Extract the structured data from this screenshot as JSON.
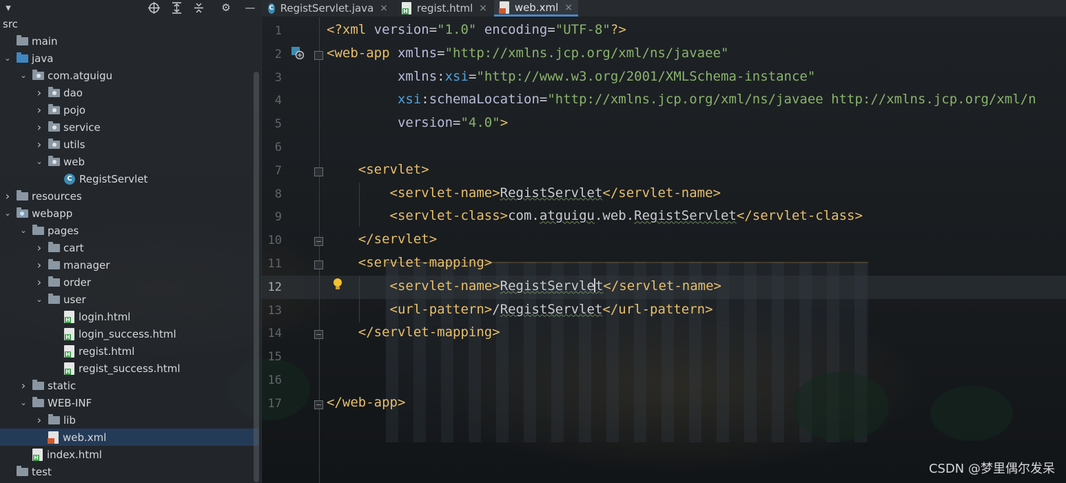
{
  "colors": {
    "tag": "#e8bf6a",
    "attribute": "#b9bcd9",
    "namespace": "#4fa3dd",
    "string": "#6a8759",
    "selection": "#254060",
    "tab_accent": "#4a88c7"
  },
  "sidebar": {
    "toolbar_icons": [
      "target-icon",
      "expand-all-icon",
      "collapse-all-icon",
      "gear-icon",
      "minimize-icon"
    ],
    "tree": [
      {
        "label": "src",
        "level": 0,
        "icon": "none",
        "chevron": "none"
      },
      {
        "label": "main",
        "level": 0,
        "icon": "folder",
        "chevron": "none"
      },
      {
        "label": "java",
        "level": 0,
        "icon": "folder-blue",
        "chevron": "open"
      },
      {
        "label": "com.atguigu",
        "level": 1,
        "icon": "package",
        "chevron": "open"
      },
      {
        "label": "dao",
        "level": 2,
        "icon": "package",
        "chevron": "closed"
      },
      {
        "label": "pojo",
        "level": 2,
        "icon": "package",
        "chevron": "closed"
      },
      {
        "label": "service",
        "level": 2,
        "icon": "package",
        "chevron": "closed"
      },
      {
        "label": "utils",
        "level": 2,
        "icon": "package",
        "chevron": "closed"
      },
      {
        "label": "web",
        "level": 2,
        "icon": "package",
        "chevron": "open"
      },
      {
        "label": "RegistServlet",
        "level": 3,
        "icon": "class",
        "chevron": "none"
      },
      {
        "label": "resources",
        "level": 0,
        "icon": "folder",
        "chevron": "closed"
      },
      {
        "label": "webapp",
        "level": 0,
        "icon": "folder-web",
        "chevron": "open"
      },
      {
        "label": "pages",
        "level": 1,
        "icon": "folder",
        "chevron": "open"
      },
      {
        "label": "cart",
        "level": 2,
        "icon": "folder",
        "chevron": "closed"
      },
      {
        "label": "manager",
        "level": 2,
        "icon": "folder",
        "chevron": "closed"
      },
      {
        "label": "order",
        "level": 2,
        "icon": "folder",
        "chevron": "closed"
      },
      {
        "label": "user",
        "level": 2,
        "icon": "folder",
        "chevron": "open"
      },
      {
        "label": "login.html",
        "level": 3,
        "icon": "html",
        "chevron": "none"
      },
      {
        "label": "login_success.html",
        "level": 3,
        "icon": "html",
        "chevron": "none"
      },
      {
        "label": "regist.html",
        "level": 3,
        "icon": "html",
        "chevron": "none"
      },
      {
        "label": "regist_success.html",
        "level": 3,
        "icon": "html",
        "chevron": "none"
      },
      {
        "label": "static",
        "level": 1,
        "icon": "folder",
        "chevron": "closed"
      },
      {
        "label": "WEB-INF",
        "level": 1,
        "icon": "folder",
        "chevron": "open"
      },
      {
        "label": "lib",
        "level": 2,
        "icon": "folder",
        "chevron": "closed"
      },
      {
        "label": "web.xml",
        "level": 2,
        "icon": "xml",
        "chevron": "none",
        "selected": true
      },
      {
        "label": "index.html",
        "level": 1,
        "icon": "html",
        "chevron": "none"
      },
      {
        "label": "test",
        "level": 0,
        "icon": "folder",
        "chevron": "none"
      }
    ]
  },
  "tabs": [
    {
      "label": "RegistServlet.java",
      "icon": "java-class-icon",
      "active": false
    },
    {
      "label": "regist.html",
      "icon": "html-file-icon",
      "active": false
    },
    {
      "label": "web.xml",
      "icon": "xml-file-icon",
      "active": true
    }
  ],
  "tab_close_glyph": "×",
  "editor": {
    "current_line": 12,
    "lines": [
      {
        "n": "1",
        "parts": [
          [
            "k",
            "<?xml "
          ],
          [
            "a",
            "version"
          ],
          [
            "t",
            "="
          ],
          [
            "v",
            "\"1.0\""
          ],
          [
            "t",
            " "
          ],
          [
            "a",
            "encoding"
          ],
          [
            "t",
            "="
          ],
          [
            "v",
            "\"UTF-8\""
          ],
          [
            "k",
            "?>"
          ]
        ]
      },
      {
        "n": "2",
        "parts": [
          [
            "k",
            "<web-app "
          ],
          [
            "a",
            "xmlns"
          ],
          [
            "t",
            "="
          ],
          [
            "v",
            "\"http://xmlns.jcp.org/xml/ns/javaee\""
          ]
        ]
      },
      {
        "n": "3",
        "parts": [
          [
            "t",
            "         "
          ],
          [
            "a",
            "xmlns"
          ],
          [
            "t",
            ":"
          ],
          [
            "ns",
            "xsi"
          ],
          [
            "t",
            "="
          ],
          [
            "v",
            "\"http://www.w3.org/2001/XMLSchema-instance\""
          ]
        ]
      },
      {
        "n": "4",
        "parts": [
          [
            "t",
            "         "
          ],
          [
            "ns",
            "xsi"
          ],
          [
            "t",
            ":"
          ],
          [
            "a",
            "schemaLocation"
          ],
          [
            "t",
            "="
          ],
          [
            "v",
            "\"http://xmlns.jcp.org/xml/ns/javaee http://xmlns.jcp.org/xml/n"
          ]
        ]
      },
      {
        "n": "5",
        "parts": [
          [
            "t",
            "         "
          ],
          [
            "a",
            "version"
          ],
          [
            "t",
            "="
          ],
          [
            "v",
            "\"4.0\""
          ],
          [
            "k",
            ">"
          ]
        ]
      },
      {
        "n": "6",
        "parts": []
      },
      {
        "n": "7",
        "parts": [
          [
            "t",
            "    "
          ],
          [
            "k",
            "<servlet>"
          ]
        ]
      },
      {
        "n": "8",
        "parts": [
          [
            "t",
            "        "
          ],
          [
            "k",
            "<servlet-name>"
          ],
          [
            "sq",
            "RegistServlet"
          ],
          [
            "k",
            "</servlet-name>"
          ]
        ]
      },
      {
        "n": "9",
        "parts": [
          [
            "t",
            "        "
          ],
          [
            "k",
            "<servlet-class>"
          ],
          [
            "t",
            "com."
          ],
          [
            "sq",
            "atguigu"
          ],
          [
            "t",
            ".web."
          ],
          [
            "sq",
            "RegistServlet"
          ],
          [
            "k",
            "</servlet-class>"
          ]
        ]
      },
      {
        "n": "10",
        "parts": [
          [
            "t",
            "    "
          ],
          [
            "k",
            "</servlet>"
          ]
        ]
      },
      {
        "n": "11",
        "parts": [
          [
            "t",
            "    "
          ],
          [
            "k",
            "<servlet-mapping>"
          ]
        ]
      },
      {
        "n": "12",
        "parts": [
          [
            "t",
            "        "
          ],
          [
            "k",
            "<servlet-name>"
          ],
          [
            "sq",
            "RegistServle"
          ],
          [
            "caret",
            ""
          ],
          [
            "sq",
            "t"
          ],
          [
            "k",
            "</servlet-name>"
          ]
        ]
      },
      {
        "n": "13",
        "parts": [
          [
            "t",
            "        "
          ],
          [
            "k",
            "<url-pattern>"
          ],
          [
            "t",
            "/"
          ],
          [
            "sq",
            "RegistServlet"
          ],
          [
            "k",
            "</url-pattern>"
          ]
        ]
      },
      {
        "n": "14",
        "parts": [
          [
            "t",
            "    "
          ],
          [
            "k",
            "</servlet-mapping>"
          ]
        ]
      },
      {
        "n": "15",
        "parts": []
      },
      {
        "n": "16",
        "parts": []
      },
      {
        "n": "17",
        "parts": [
          [
            "k",
            "</web-app>"
          ]
        ]
      }
    ]
  },
  "watermark": "CSDN @梦里偶尔发呆"
}
